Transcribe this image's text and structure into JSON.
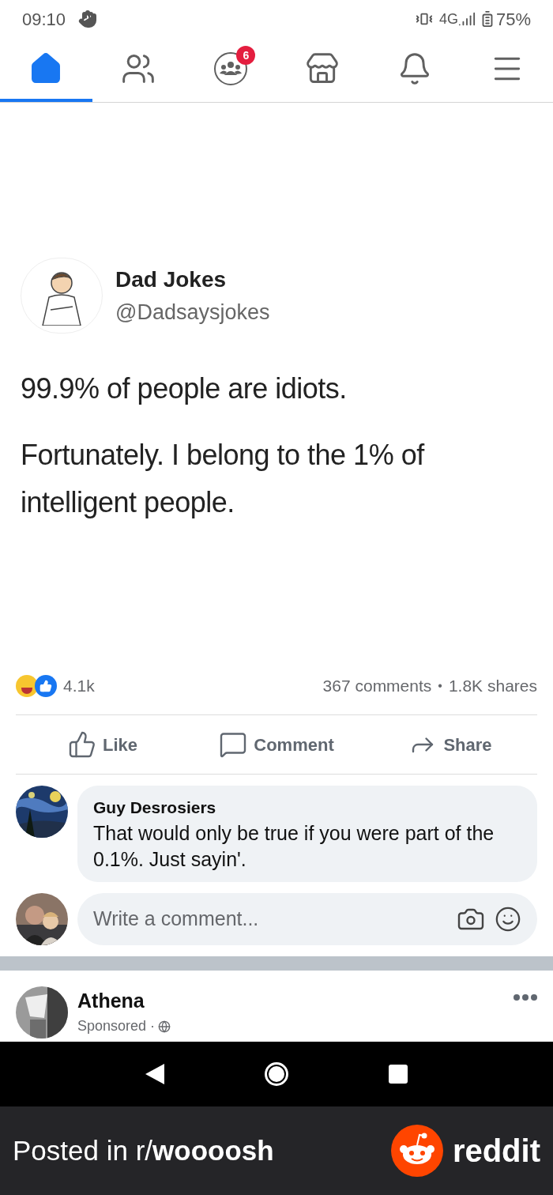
{
  "status_bar": {
    "time": "09:10",
    "network": "4G",
    "battery": "75%"
  },
  "nav_tabs": [
    {
      "kind": "home",
      "selected": true
    },
    {
      "kind": "friends",
      "selected": false
    },
    {
      "kind": "groups",
      "selected": false,
      "badge": "6"
    },
    {
      "kind": "marketplace",
      "selected": false
    },
    {
      "kind": "notifications",
      "selected": false
    },
    {
      "kind": "menu",
      "selected": false
    }
  ],
  "post": {
    "author_name": "Dad Jokes",
    "handle": "@Dadsaysjokes",
    "paragraphs": [
      "99.9% of people are idiots.",
      "Fortunately. I belong to the 1% of intelligent people."
    ],
    "reactions_count": "4.1k",
    "comments_count": "367 comments",
    "separator": "•",
    "shares_count": "1.8K shares",
    "actions": [
      {
        "kind": "like",
        "label": "Like"
      },
      {
        "kind": "comment",
        "label": "Comment"
      },
      {
        "kind": "share",
        "label": "Share"
      }
    ]
  },
  "comments": [
    {
      "author": "Guy Desrosiers",
      "text": "That would only be true if you were part of the 0.1%. Just sayin'."
    }
  ],
  "composer": {
    "placeholder": "Write a comment..."
  },
  "next_post": {
    "author": "Athena",
    "meta": "Sponsored ·"
  },
  "footer": {
    "caption": "Posted in r/**woooosh**",
    "brand": "reddit"
  }
}
